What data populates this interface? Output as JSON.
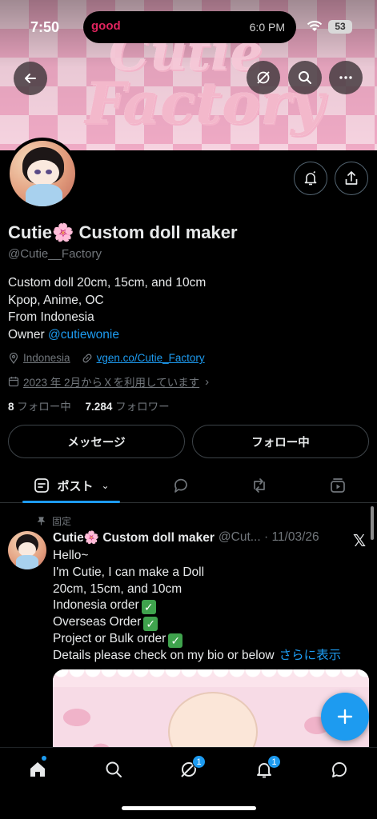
{
  "status_bar": {
    "time": "7:50",
    "island_left": "good",
    "island_right": "6:0 PM",
    "battery": "53"
  },
  "banner": {
    "logo_line1": "Cutie",
    "logo_line2": "Factory"
  },
  "profile": {
    "display_name": "Cutie🌸 Custom doll maker",
    "handle": "@Cutie__Factory",
    "bio_lines": [
      "Custom doll 20cm, 15cm, and 10cm",
      "Kpop, Anime, OC",
      "From Indonesia"
    ],
    "owner_prefix": "Owner ",
    "owner_mention": "@cutiewonie",
    "location": "Indonesia",
    "website": "vgen.co/Cutie_Factory",
    "joined": "2023 年 2月からＸを利用しています",
    "following_count": "8",
    "following_label": "フォロー中",
    "followers_count": "7.284",
    "followers_label": "フォロワー",
    "message_button": "メッセージ",
    "following_button": "フォロー中"
  },
  "tabs": {
    "posts_label": "ポスト"
  },
  "post": {
    "pinned_label": "固定",
    "author_name": "Cutie🌸 Custom doll maker",
    "author_handle_date": "@Cut... · 11/03/26",
    "lines": [
      "Hello~",
      "I'm Cutie, I can make a Doll",
      "20cm, 15cm, and 10cm",
      "Indonesia order",
      "Overseas Order",
      "Project or Bulk order",
      "Details please check on my bio or below"
    ],
    "check_mark": "✓",
    "show_more": "さらに表示"
  },
  "bottom_nav": {
    "grok_badge": "1",
    "notifications_badge": "1"
  },
  "colors": {
    "accent": "#1d9bf0",
    "background": "#000000",
    "muted": "#71767b"
  },
  "icons": [
    "back-arrow-icon",
    "grok-icon",
    "search-icon",
    "more-icon",
    "notify-bell-icon",
    "share-icon",
    "location-icon",
    "link-icon",
    "calendar-icon",
    "posts-icon",
    "chevron-down-icon",
    "replies-icon",
    "repost-icon",
    "media-icon",
    "pin-icon",
    "x-logo-icon",
    "compose-plus-icon",
    "home-icon",
    "grok-nav-icon",
    "notifications-icon",
    "messages-icon"
  ]
}
